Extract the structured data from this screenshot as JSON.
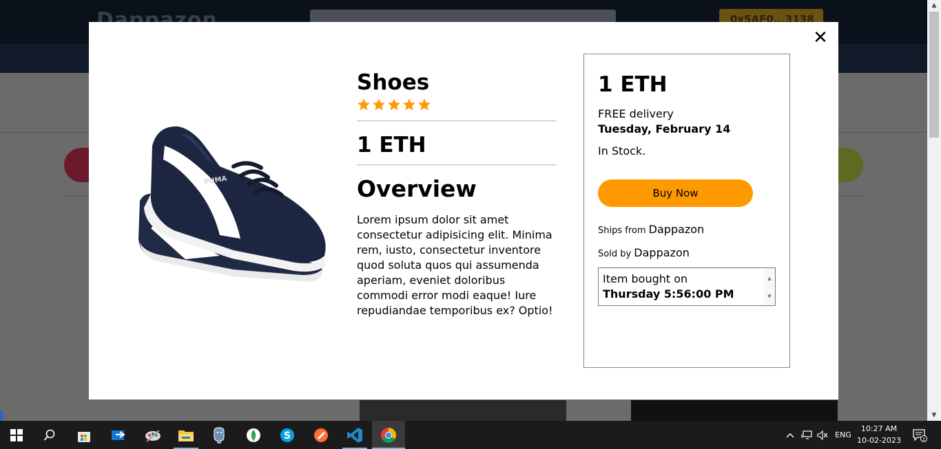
{
  "background": {
    "site_logo": "Dappazon",
    "account_label": "0x5AF0...3138"
  },
  "product": {
    "name": "Shoes",
    "rating": 5,
    "price": "1 ETH",
    "overview_heading": "Overview",
    "description": "Lorem ipsum dolor sit amet consectetur adipisicing elit. Minima rem, iusto, consectetur inventore quod soluta quos qui assumenda aperiam, eveniet doloribus commodi error modi eaque! Iure repudiandae temporibus ex? Optio!",
    "image_icon": "sneaker-image"
  },
  "order": {
    "price": "1 ETH",
    "delivery_label": "FREE delivery",
    "delivery_date": "Tuesday, February 14",
    "stock": "In Stock.",
    "buy_label": "Buy Now",
    "ships_from_label": "Ships from",
    "ships_from_value": "Dappazon",
    "sold_by_label": "Sold by",
    "sold_by_value": "Dappazon",
    "bought_label": "Item bought on",
    "bought_time": "Thursday 5:56:00 PM"
  },
  "close_icon": "close-icon",
  "colors": {
    "accent": "#ff9900",
    "star": "#ff9900",
    "modal_bg": "#ffffff",
    "taskbar_bg": "#1b1b1b"
  },
  "taskbar": {
    "icons": [
      "windows-start-icon",
      "search-icon",
      "microsoft-store-icon",
      "mail-icon",
      "paint-icon",
      "file-explorer-icon",
      "postgresql-icon",
      "mongodb-icon",
      "skype-icon",
      "postman-icon",
      "vscode-icon",
      "chrome-icon"
    ],
    "language": "ENG",
    "time": "10:27 AM",
    "date": "10-02-2023",
    "notification_count": "1"
  }
}
